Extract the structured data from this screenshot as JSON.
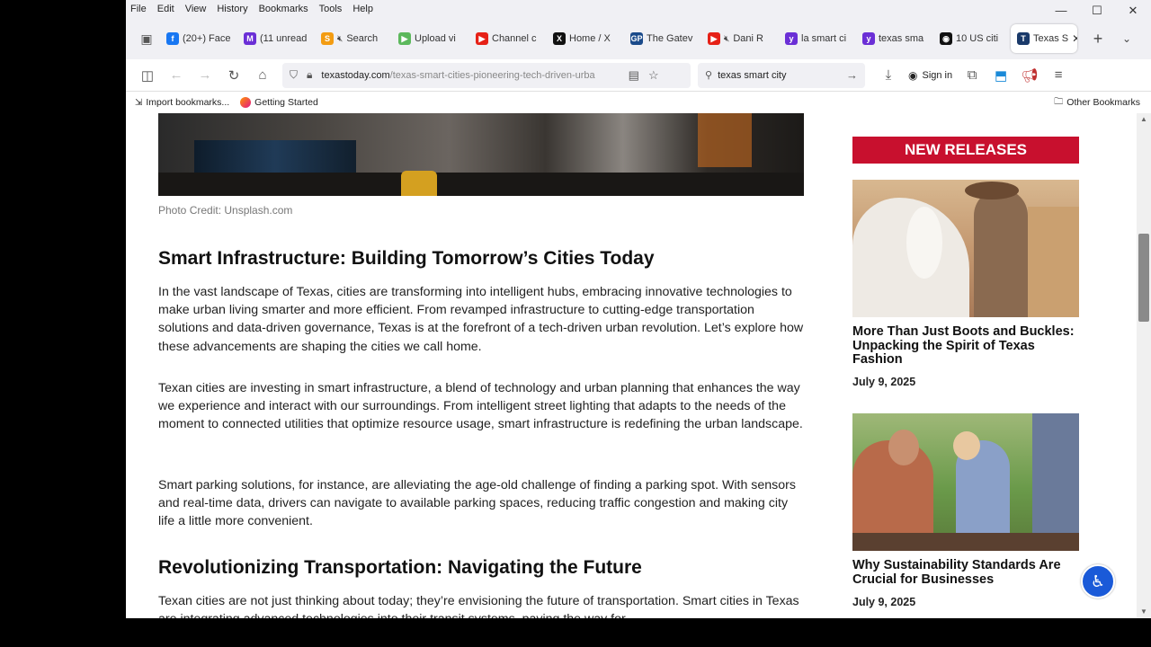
{
  "menu": [
    "File",
    "Edit",
    "View",
    "History",
    "Bookmarks",
    "Tools",
    "Help"
  ],
  "window_controls": {
    "minimize": "—",
    "maximize": "☐",
    "close": "✕"
  },
  "tabs": [
    {
      "label": "(20+) Face",
      "color": "#1877f2",
      "glyph": "f",
      "muted": false
    },
    {
      "label": "(11 unread",
      "color": "#6b2fd6",
      "glyph": "M",
      "muted": false
    },
    {
      "label": "Search",
      "color": "#f39c12",
      "glyph": "S",
      "muted": true
    },
    {
      "label": "Upload vi",
      "color": "#5cb85c",
      "glyph": "▶",
      "muted": false
    },
    {
      "label": "Channel c",
      "color": "#e62117",
      "glyph": "▶",
      "muted": false
    },
    {
      "label": "Home / X",
      "color": "#111111",
      "glyph": "X",
      "muted": false
    },
    {
      "label": "The Gatev",
      "color": "#1a4a8a",
      "glyph": "GP",
      "muted": false
    },
    {
      "label": "Dani R",
      "color": "#e62117",
      "glyph": "▶",
      "muted": true
    },
    {
      "label": "la smart ci",
      "color": "#6b2fd6",
      "glyph": "y",
      "muted": false
    },
    {
      "label": "texas sma",
      "color": "#6b2fd6",
      "glyph": "y",
      "muted": false
    },
    {
      "label": "10 US citi",
      "color": "#111111",
      "glyph": "◉",
      "muted": false
    },
    {
      "label": "Texas S",
      "color": "#1a3a6a",
      "glyph": "T",
      "muted": false,
      "active": true
    }
  ],
  "url": {
    "domain": "texastoday.com",
    "path": "/texas-smart-cities-pioneering-tech-driven-urba"
  },
  "search": {
    "value": "texas smart city"
  },
  "signin_label": "Sign in",
  "bookmarks": {
    "import_label": "Import bookmarks...",
    "getting_started": "Getting Started",
    "other": "Other Bookmarks"
  },
  "article": {
    "photo_credit": "Photo Credit: Unsplash.com",
    "heading1": "Smart Infrastructure: Building Tomorrow’s Cities Today",
    "para1": "In the vast landscape of Texas, cities are transforming into intelligent hubs, embracing innovative technologies to make urban living smarter and more efficient. From revamped infrastructure to cutting-edge transportation solutions and data-driven governance, Texas is at the forefront of a tech-driven urban revolution. Let’s explore how these advancements are shaping the cities we call home.",
    "para2": "Texan cities are investing in smart infrastructure, a blend of technology and urban planning that enhances the way we experience and interact with our surroundings. From intelligent street lighting that adapts to the needs of the moment to connected utilities that optimize resource usage, smart infrastructure is redefining the urban landscape.",
    "para3": "Smart parking solutions, for instance, are alleviating the age-old challenge of finding a parking spot. With sensors and real-time data, drivers can navigate to available parking spaces, reducing traffic congestion and making city life a little more convenient.",
    "heading2": "Revolutionizing Transportation: Navigating the Future",
    "para4": "Texan cities are not just thinking about today; they’re envisioning the future of transportation. Smart cities in Texas are integrating advanced technologies into their transit systems, paving the way for"
  },
  "sidebar": {
    "header": "NEW RELEASES",
    "cards": [
      {
        "title": "More Than Just Boots and Buckles: Unpacking the Spirit of Texas Fashion",
        "date": "July 9, 2025"
      },
      {
        "title": "Why Sustainability Standards Are Crucial for Businesses",
        "date": "July 9, 2025"
      }
    ]
  },
  "colors": {
    "accent_red": "#c8102e",
    "a11y_blue": "#1a5ad8"
  }
}
